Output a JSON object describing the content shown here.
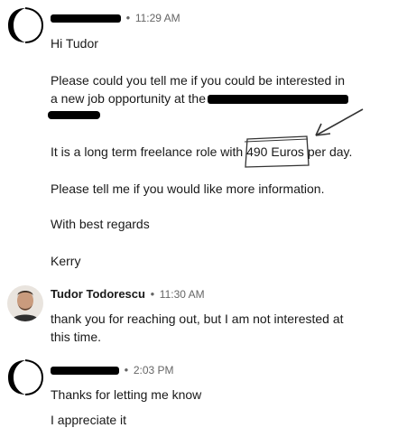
{
  "messages": [
    {
      "time": "11:29 AM",
      "lines": [
        "Hi Tudor",
        "Please could you tell me if you could be interested in",
        "a new job opportunity at the",
        "It is a long term freelance role with",
        "490 Euros",
        "per day.",
        "Please tell me if you would like more information.",
        "With best regards",
        "Kerry"
      ]
    },
    {
      "sender": "Tudor Todorescu",
      "time": "11:30 AM",
      "lines": [
        "thank you for reaching out, but I am not interested at",
        "this time."
      ]
    },
    {
      "time": "2:03 PM",
      "lines": [
        "Thanks for letting me know",
        "I appreciate it"
      ]
    }
  ],
  "separator": "•"
}
